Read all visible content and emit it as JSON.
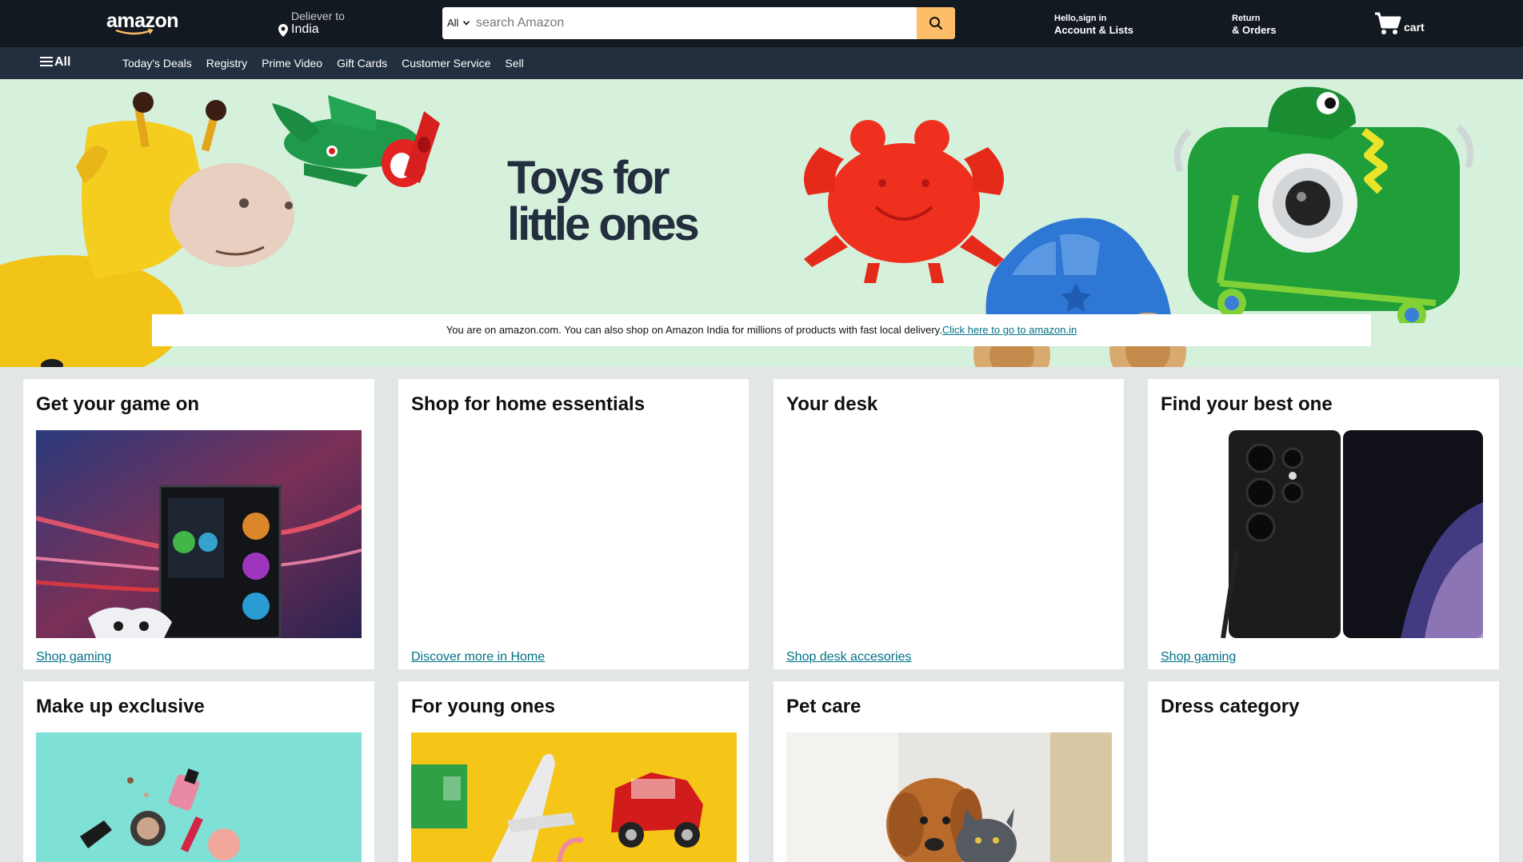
{
  "header": {
    "logo": "amazon",
    "deliver_label": "Deliever to",
    "deliver_location": "India",
    "search_category": "All",
    "search_placeholder": "search Amazon",
    "account_greeting": "Hello,sign in",
    "account_label": "Account & Lists",
    "returns_label": "Return",
    "orders_label": "& Orders",
    "cart_label": "cart"
  },
  "nav": {
    "all_label": "All",
    "links": [
      "Today's Deals",
      "Registry",
      "Prime Video",
      "Gift Cards",
      "Customer Service",
      "Sell"
    ]
  },
  "hero": {
    "title_line1": "Toys for",
    "title_line2": "little ones",
    "notice_text": "You are on amazon.com. You can also shop on Amazon India for millions of products with fast local delivery.",
    "notice_link": "Click here to go to amazon.in"
  },
  "cards": [
    {
      "title": "Get your game on",
      "link": "Shop gaming"
    },
    {
      "title": "Shop for home essentials",
      "link": "Discover more in Home"
    },
    {
      "title": "Your desk",
      "link": "Shop desk accesories"
    },
    {
      "title": "Find your best one",
      "link": "Shop gaming"
    },
    {
      "title": "Make up exclusive",
      "link": ""
    },
    {
      "title": "For young ones",
      "link": ""
    },
    {
      "title": "Pet care",
      "link": ""
    },
    {
      "title": "Dress category",
      "link": ""
    }
  ],
  "colors": {
    "header_bg": "#131921",
    "nav_bg": "#232f3e",
    "search_button": "#febd69",
    "hero_bg": "#d5f0db",
    "page_bg": "#e3e6e6",
    "link": "#007185"
  }
}
